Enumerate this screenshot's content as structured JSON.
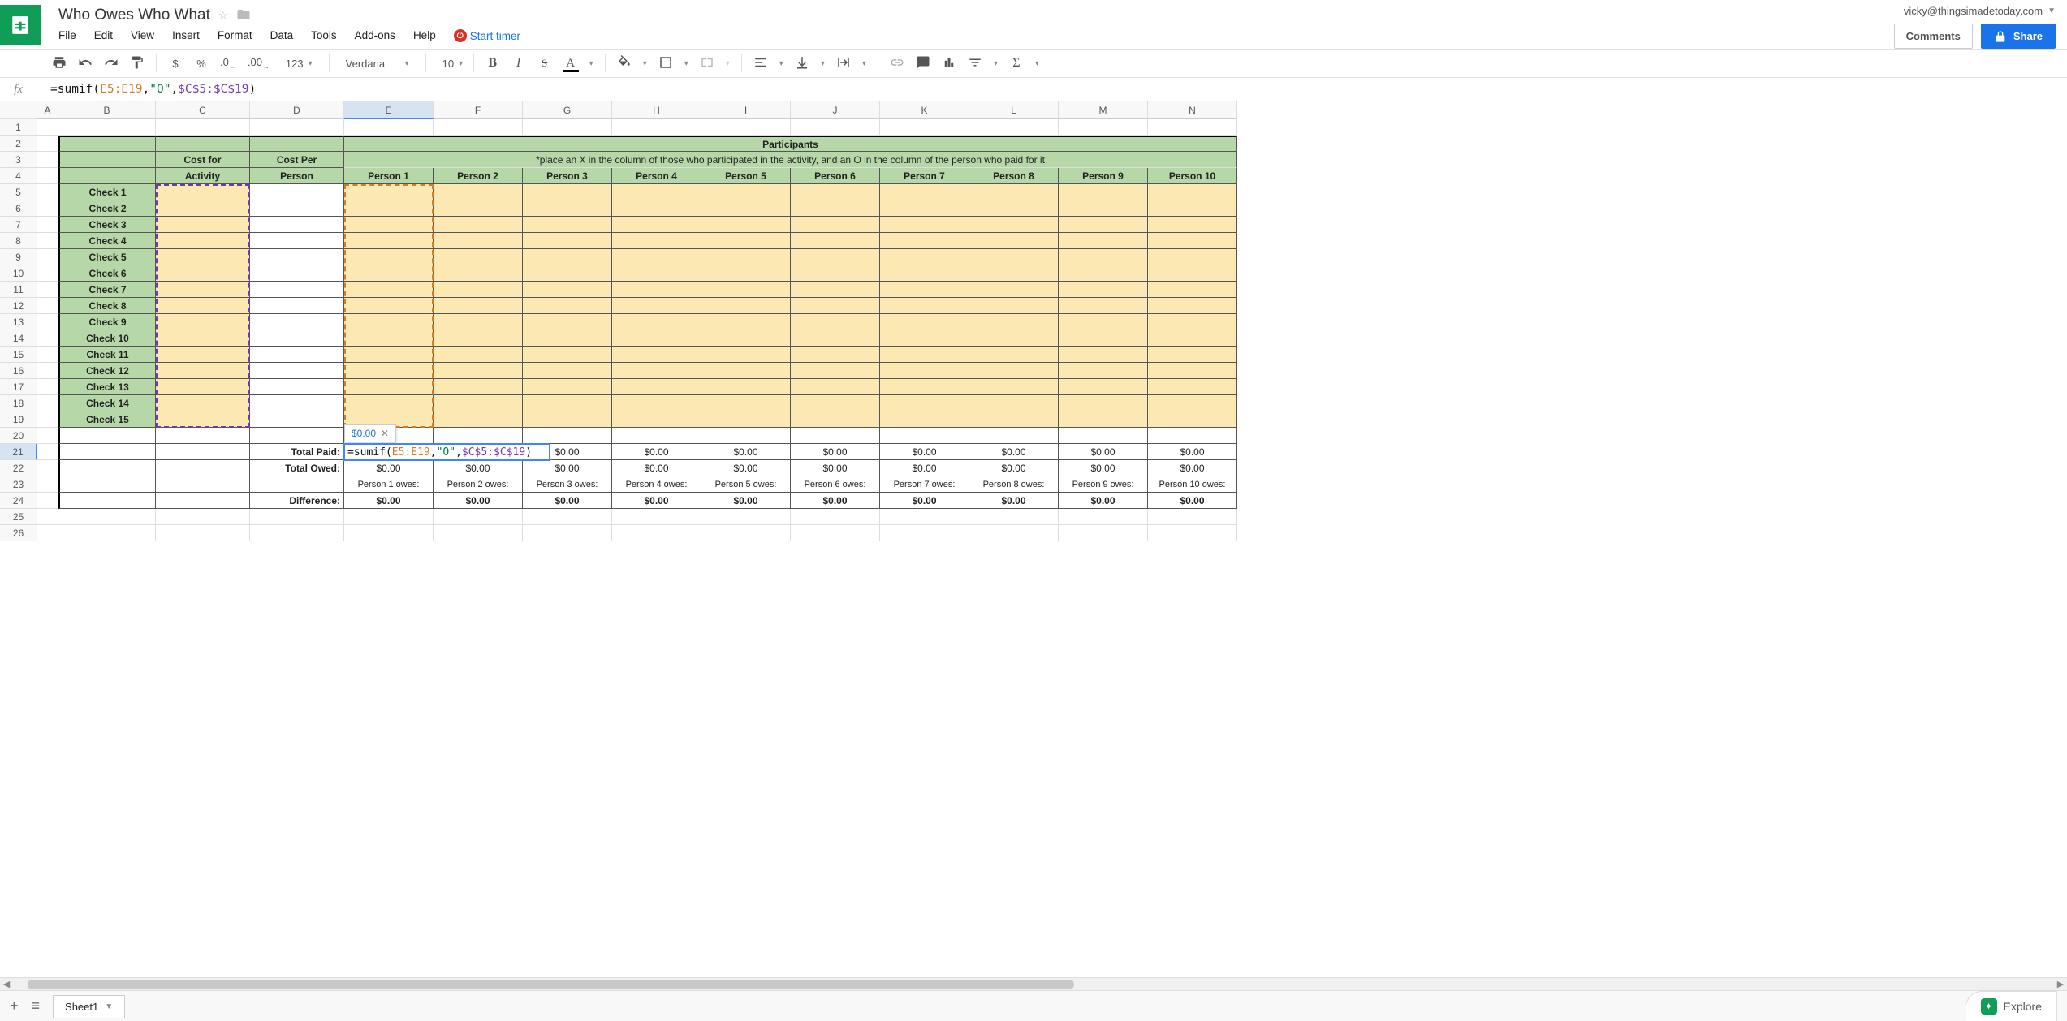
{
  "document": {
    "title": "Who Owes Who What",
    "account_email": "vicky@thingsimadetoday.com"
  },
  "menu": {
    "file": "File",
    "edit": "Edit",
    "view": "View",
    "insert": "Insert",
    "format": "Format",
    "data": "Data",
    "tools": "Tools",
    "addons": "Add-ons",
    "help": "Help",
    "start_timer": "Start timer"
  },
  "buttons": {
    "comments": "Comments",
    "share": "Share",
    "explore": "Explore"
  },
  "toolbar": {
    "currency": "$",
    "percent": "%",
    "dec_less": ".0",
    "dec_more": ".00",
    "format_123": "123",
    "font_name": "Verdana",
    "font_size": "10",
    "bold": "B",
    "italic": "I",
    "strike": "S",
    "text_color": "A"
  },
  "formula_bar": {
    "prefix": "=sumif(",
    "range1": "E5:E19",
    "sep1": ",",
    "str": "\"O\"",
    "sep2": ",",
    "range2": "$C$5:$C$19",
    "suffix": ")"
  },
  "columns": [
    "A",
    "B",
    "C",
    "D",
    "E",
    "F",
    "G",
    "H",
    "I",
    "J",
    "K",
    "L",
    "M",
    "N"
  ],
  "row_numbers": [
    "1",
    "2",
    "3",
    "4",
    "5",
    "6",
    "7",
    "8",
    "9",
    "10",
    "11",
    "12",
    "13",
    "14",
    "15",
    "16",
    "17",
    "18",
    "19",
    "20",
    "21",
    "22",
    "23",
    "24",
    "25",
    "26"
  ],
  "template": {
    "cost_for_activity_1": "Cost for",
    "cost_for_activity_2": "Activity",
    "cost_per_person_1": "Cost Per",
    "cost_per_person_2": "Person",
    "participants": "Participants",
    "instruction": "*place an X in the column of those who participated in the activity, and an O in the column of the person who paid for it",
    "checks": [
      "Check 1",
      "Check 2",
      "Check 3",
      "Check 4",
      "Check 5",
      "Check 6",
      "Check 7",
      "Check 8",
      "Check 9",
      "Check 10",
      "Check 11",
      "Check 12",
      "Check 13",
      "Check 14",
      "Check 15"
    ],
    "persons": [
      "Person 1",
      "Person 2",
      "Person 3",
      "Person 4",
      "Person 5",
      "Person 6",
      "Person 7",
      "Person 8",
      "Person 9",
      "Person 10"
    ],
    "total_paid": "Total Paid:",
    "total_owed": "Total Owed:",
    "difference": "Difference:",
    "owes_labels": [
      "Person 1 owes:",
      "Person 2 owes:",
      "Person 3 owes:",
      "Person 4 owes:",
      "Person 5 owes:",
      "Person 6 owes:",
      "Person 7 owes:",
      "Person 8 owes:",
      "Person 9 owes:",
      "Person 10 owes:"
    ],
    "zero": "$0.00",
    "edit_tooltip": "$0.00"
  },
  "sheet_tab": {
    "name": "Sheet1"
  }
}
